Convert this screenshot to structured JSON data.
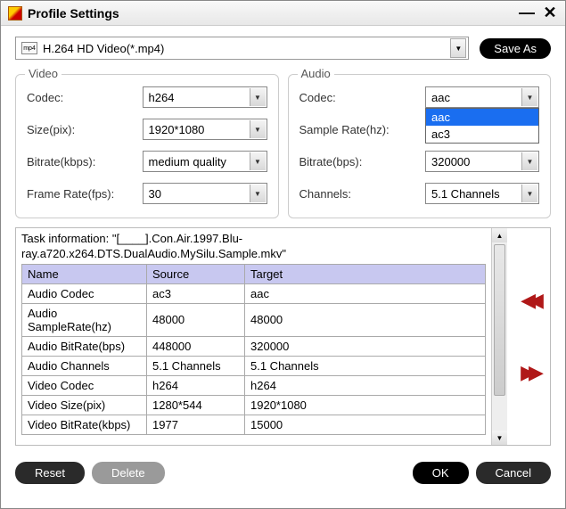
{
  "window": {
    "title": "Profile Settings"
  },
  "profile": {
    "selected": "H.264 HD Video(*.mp4)",
    "icon_label": "mp4",
    "save_as": "Save As"
  },
  "video": {
    "title": "Video",
    "codec_label": "Codec:",
    "codec_value": "h264",
    "size_label": "Size(pix):",
    "size_value": "1920*1080",
    "bitrate_label": "Bitrate(kbps):",
    "bitrate_value": "medium quality",
    "framerate_label": "Frame Rate(fps):",
    "framerate_value": "30"
  },
  "audio": {
    "title": "Audio",
    "codec_label": "Codec:",
    "codec_value": "aac",
    "codec_options": [
      "aac",
      "ac3"
    ],
    "samplerate_label": "Sample Rate(hz):",
    "samplerate_value": "",
    "bitrate_label": "Bitrate(bps):",
    "bitrate_value": "320000",
    "channels_label": "Channels:",
    "channels_value": "5.1 Channels"
  },
  "task": {
    "info_line1": "Task information: \"[____].Con.Air.1997.Blu-",
    "info_line2": "ray.a720.x264.DTS.DualAudio.MySilu.Sample.mkv\"",
    "headers": {
      "name": "Name",
      "source": "Source",
      "target": "Target"
    },
    "rows": [
      {
        "name": "Audio Codec",
        "source": "ac3",
        "target": "aac"
      },
      {
        "name": "Audio SampleRate(hz)",
        "source": "48000",
        "target": "48000"
      },
      {
        "name": "Audio BitRate(bps)",
        "source": "448000",
        "target": "320000"
      },
      {
        "name": "Audio Channels",
        "source": "5.1 Channels",
        "target": "5.1 Channels"
      },
      {
        "name": "Video Codec",
        "source": "h264",
        "target": "h264"
      },
      {
        "name": "Video Size(pix)",
        "source": "1280*544",
        "target": "1920*1080"
      },
      {
        "name": "Video BitRate(kbps)",
        "source": "1977",
        "target": "15000"
      }
    ]
  },
  "buttons": {
    "reset": "Reset",
    "delete": "Delete",
    "ok": "OK",
    "cancel": "Cancel"
  }
}
